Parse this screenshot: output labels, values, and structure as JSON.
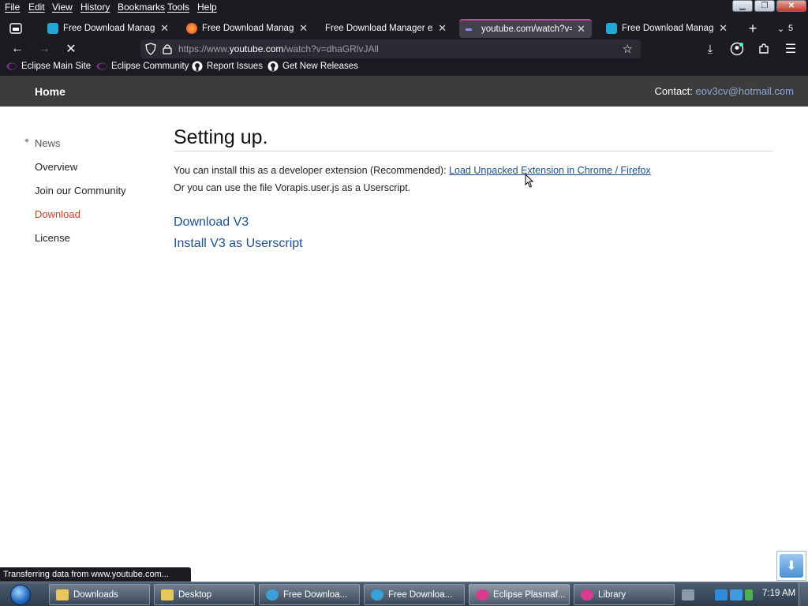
{
  "menubar": {
    "items": [
      "File",
      "Edit",
      "View",
      "History",
      "Bookmarks",
      "Tools",
      "Help"
    ]
  },
  "tabs": [
    {
      "title": "Free Download Manager",
      "favicon": "fdm-icon",
      "active": false
    },
    {
      "title": "Free Download Manager",
      "favicon": "firefox-icon",
      "active": false
    },
    {
      "title": "Free Download Manager exte",
      "favicon": "none",
      "active": false
    },
    {
      "title": "youtube.com/watch?v=dl",
      "favicon": "loading-icon",
      "active": true
    },
    {
      "title": "Free Download Manager",
      "favicon": "fdm-icon",
      "active": false
    }
  ],
  "tab_count": "5",
  "url": {
    "prefix": "https://www.",
    "domain": "youtube.com",
    "path": "/watch?v=dhaGRlvJAll"
  },
  "bookmarks": [
    {
      "label": "Eclipse Main Site",
      "icon": "eclipse-icon"
    },
    {
      "label": "Eclipse Community",
      "icon": "eclipse-icon"
    },
    {
      "label": "Report Issues",
      "icon": "github-icon"
    },
    {
      "label": "Get New Releases",
      "icon": "github-icon"
    }
  ],
  "site": {
    "home": "Home",
    "contact_label": "Contact:",
    "contact_email": "eov3cv@hotmail.com"
  },
  "sidenav": [
    "News",
    "Overview",
    "Join our Community",
    "Download",
    "License"
  ],
  "content": {
    "heading": "Setting up.",
    "line1_text": "You can install this as a developer extension (Recommended):",
    "line1_link": "Load Unpacked Extension in Chrome / Firefox",
    "line2_text": "Or you can use the file Vorapis.user.js as a Userscript.",
    "download_link": "Download V3",
    "userscript_link": "Install V3 as Userscript"
  },
  "status": "Transferring data from www.youtube.com...",
  "taskbar": {
    "items": [
      {
        "label": "Downloads",
        "icon": "folder-icon"
      },
      {
        "label": "Desktop",
        "icon": "folder-icon"
      },
      {
        "label": "Free Downloa...",
        "icon": "fdm-icon"
      },
      {
        "label": "Free Downloa...",
        "icon": "fdm-icon"
      },
      {
        "label": "Eclipse Plasmaf...",
        "icon": "eclipse-icon"
      },
      {
        "label": "Library",
        "icon": "eclipse-icon"
      }
    ],
    "clock": "7:19 AM"
  },
  "colors": {
    "accent_tab": "#d83ba5",
    "current_nav": "#c2412a",
    "link": "#1f4f8f",
    "contact_link": "#8fa7d3"
  }
}
